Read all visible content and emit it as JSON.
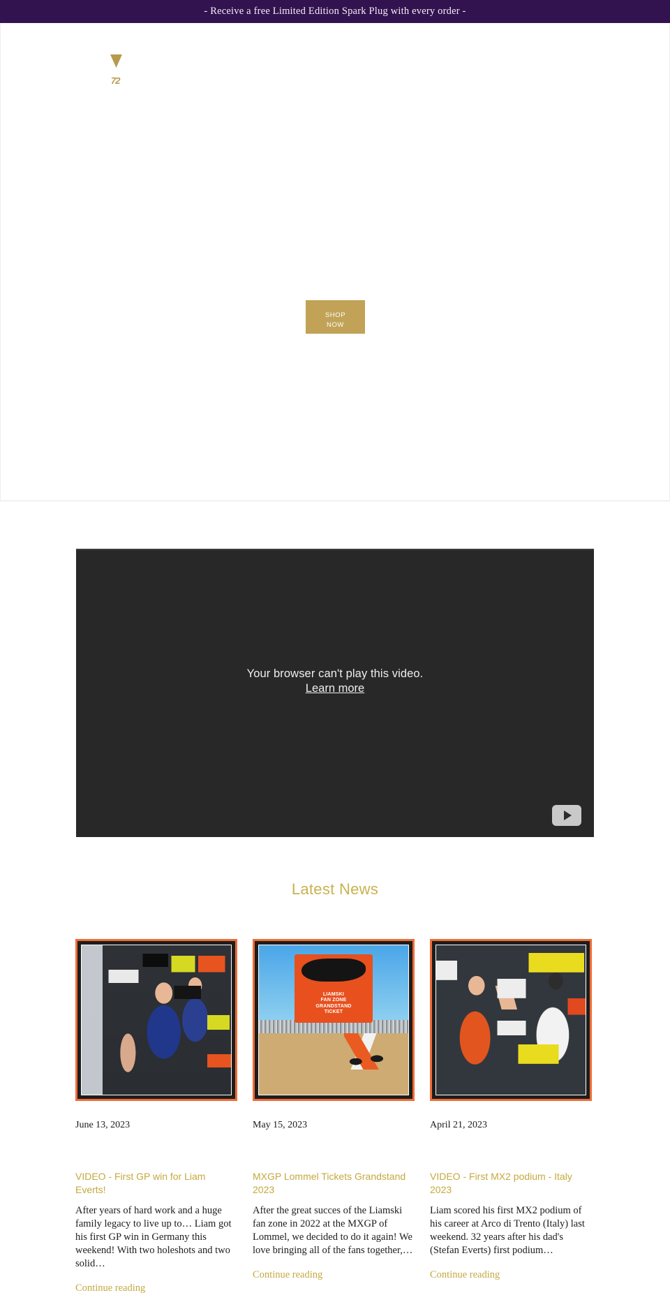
{
  "announcement": {
    "text": "- Receive a free Limited Edition Spark Plug with every order -"
  },
  "header": {
    "logo_mark": "triangle-logo-glyph",
    "logo_wordmark": "72"
  },
  "hero": {
    "cta_line1": "SHOP",
    "cta_line2": "NOW"
  },
  "video": {
    "error_message": "Your browser can't play this video.",
    "learn_more_label": "Learn more",
    "play_button_icon": "play-icon"
  },
  "news": {
    "heading": "Latest News",
    "continue_label": "Continue reading",
    "articles": [
      {
        "date": "June 13, 2023",
        "title": "VIDEO - First GP win for Liam Everts!",
        "excerpt": "After years of hard work and a huge family legacy to live up to… Liam got his first GP win in Germany this weekend! With two holeshots and two solid…",
        "thumb_alt": "motocross-podium-celebration"
      },
      {
        "date": "May 15, 2023",
        "title": "MXGP Lommel Tickets Grandstand 2023",
        "excerpt": "After the great succes of the Liamski fan zone in 2022 at the MXGP of Lommel, we decided to do it again! We love bringing all of the fans together,…",
        "thumb_alt": "liamski-fan-zone-grandstand-ticket-poster",
        "poster_line1": "LIAMSKI",
        "poster_line2": "FAN ZONE",
        "poster_line3": "GRANDSTAND",
        "poster_line4": "TICKET"
      },
      {
        "date": "April 21, 2023",
        "title": "VIDEO - First MX2 podium - Italy 2023",
        "excerpt": "Liam scored his first MX2 podium of his career at Arco di Trento (Italy) last weekend. 32 years after his dad's (Stefan Everts) first podium…",
        "thumb_alt": "riders-celebrating-on-podium"
      }
    ]
  },
  "colors": {
    "announcement_bg": "#32134f",
    "gold": "#c5a83f",
    "cta_gold": "#c1a257",
    "thumb_border": "#f06b35"
  }
}
